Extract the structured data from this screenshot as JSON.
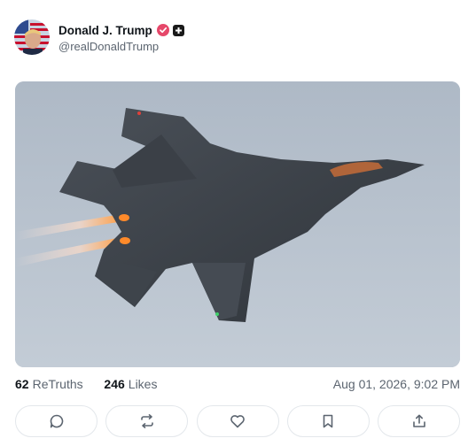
{
  "post": {
    "author_name": "Donald J. Trump",
    "handle": "@realDonaldTrump",
    "retruths_count": "62",
    "retruths_label": "ReTruths",
    "likes_count": "246",
    "likes_label": "Likes",
    "timestamp": "Aug 01, 2026, 9:02 PM"
  },
  "icons": {
    "verified": "verified-check-icon",
    "plus_badge": "plus-badge-icon",
    "reply": "reply-icon",
    "retruth": "retruth-icon",
    "like": "heart-icon",
    "bookmark": "bookmark-icon",
    "share": "share-icon"
  },
  "colors": {
    "verified": "#e6486a",
    "text_primary": "#0f1419",
    "text_secondary": "#5c6570",
    "border": "#e3e7eb"
  }
}
